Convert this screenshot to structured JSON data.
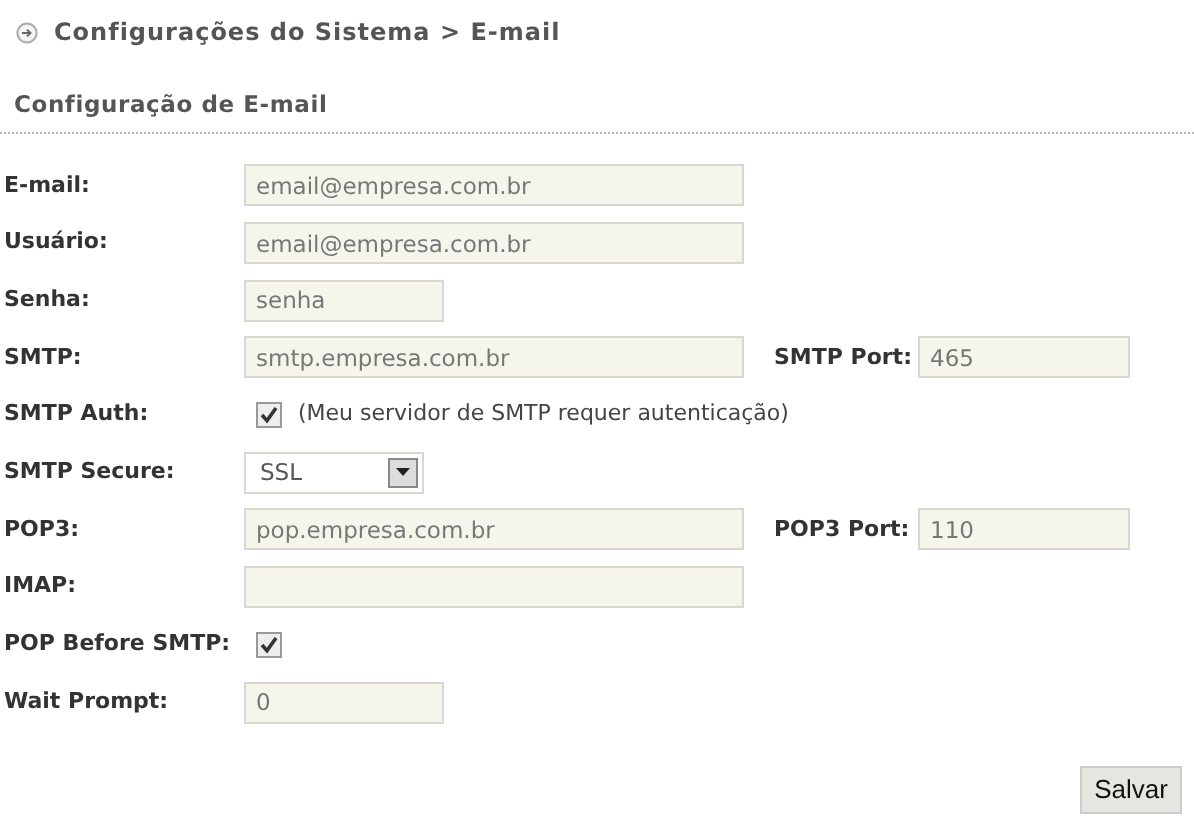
{
  "breadcrumb": "Configurações do Sistema > E-mail",
  "section_title": "Configuração de E-mail",
  "fields": [
    {
      "label": "E-mail:",
      "kind": "text",
      "value": "email@empresa.com.br"
    },
    {
      "label": "Usuário:",
      "kind": "text",
      "value": "email@empresa.com.br"
    },
    {
      "label": "Senha:",
      "kind": "short",
      "value": "senha"
    },
    {
      "label": "SMTP:",
      "kind": "text",
      "value": "smtp.empresa.com.br",
      "extra": {
        "label": "SMTP Port:",
        "value": "465"
      }
    },
    {
      "label": "SMTP Auth:",
      "kind": "checkbox",
      "checked": true,
      "note": "(Meu servidor de SMTP requer autenticação)"
    },
    {
      "label": "SMTP Secure:",
      "kind": "select",
      "value": "SSL"
    },
    {
      "label": "POP3:",
      "kind": "text",
      "value": "pop.empresa.com.br",
      "extra": {
        "label": "POP3 Port:",
        "value": "110"
      }
    },
    {
      "label": "IMAP:",
      "kind": "text"
    },
    {
      "label": "POP Before SMTP:",
      "kind": "checkbox",
      "checked": true
    },
    {
      "label": "Wait Prompt:",
      "kind": "short",
      "value": "0"
    }
  ],
  "save_button": "Salvar"
}
